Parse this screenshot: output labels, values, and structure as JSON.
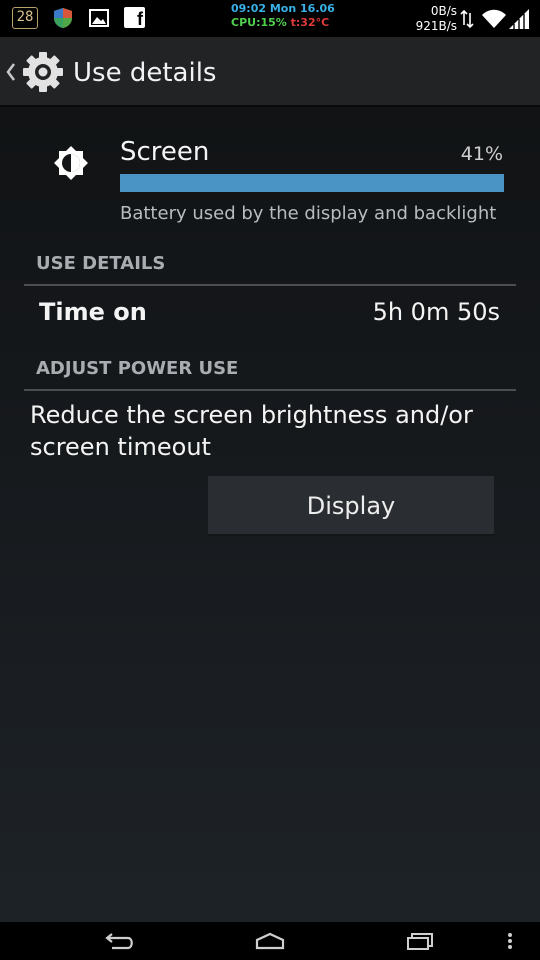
{
  "status_bar": {
    "notification_badge": "28",
    "time_date": "09:02 Mon 16.06",
    "cpu_label": "CPU:15%",
    "temp_label": "t:32°C",
    "net_up": "0B/s",
    "net_down": "921B/s",
    "icons": [
      "badge-28",
      "shield-icon",
      "gallery-icon",
      "facebook-icon",
      "data-arrows-icon",
      "wifi-icon",
      "signal-icon"
    ]
  },
  "action_bar": {
    "title": "Use details",
    "icon": "gear-icon"
  },
  "usage_item": {
    "name": "Screen",
    "percent_label": "41%",
    "percent_value": 41,
    "description": "Battery used by the display and backlight",
    "icon": "brightness-icon",
    "bar_color": "#4a93c5"
  },
  "sections": {
    "use_details": {
      "header": "USE DETAILS",
      "rows": [
        {
          "label": "Time on",
          "value": "5h 0m 50s"
        }
      ]
    },
    "adjust_power": {
      "header": "ADJUST POWER USE",
      "advice": "Reduce the screen brightness and/or screen timeout",
      "button_label": "Display"
    }
  },
  "nav_bar": {
    "icons": [
      "back-icon",
      "home-icon",
      "recent-apps-icon",
      "menu-icon"
    ]
  },
  "colors": {
    "accent": "#4a93c5",
    "time_color": "#3ab0e8",
    "cpu_color": "#4fd04f",
    "temp_color": "#e03a3a"
  }
}
